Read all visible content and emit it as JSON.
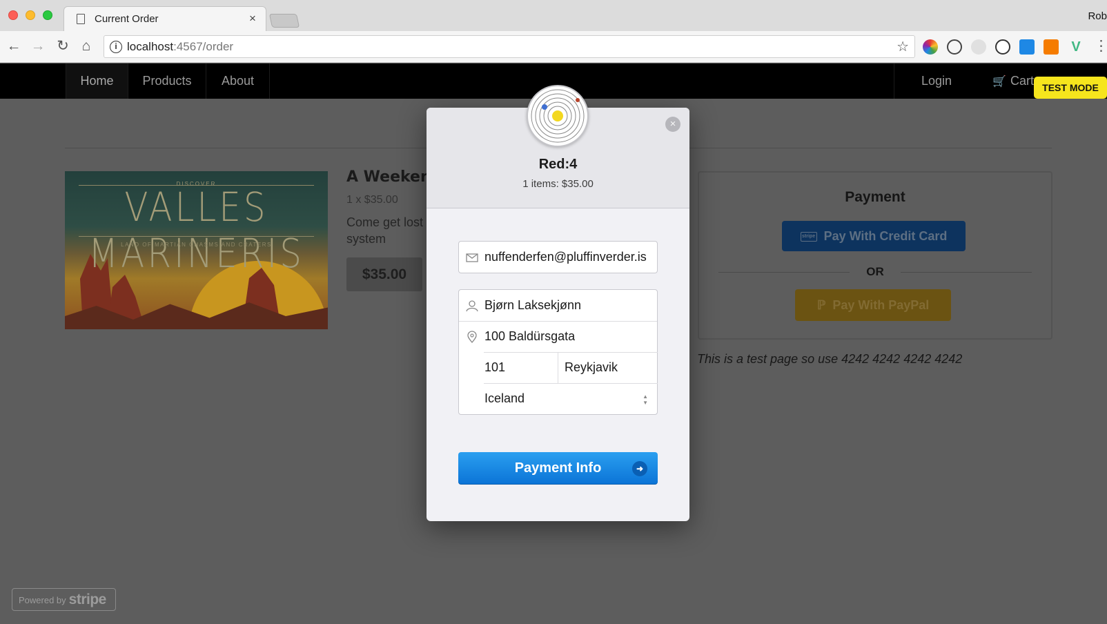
{
  "browser": {
    "tab_title": "Current Order",
    "tab_close": "×",
    "user_name": "Rob",
    "url_host": "localhost",
    "url_rest": ":4567/order"
  },
  "site_nav": {
    "items": [
      "Home",
      "Products",
      "About"
    ],
    "login": "Login",
    "cart": "Cart",
    "test_mode": "TEST MODE"
  },
  "product": {
    "poster_kicker": "DISCOVER",
    "poster_title": "VALLES MARINERIS",
    "poster_subtitle": "LAND OF MARTIAN CHASMS AND CRATERS",
    "title": "A Weekend",
    "qty_price": "1 x $35.00",
    "description": "Come get lost system",
    "price": "$35.00"
  },
  "payment_panel": {
    "heading": "Payment",
    "credit_card_label": "Pay With Credit Card",
    "stripe_mark": "stripe",
    "or_label": "OR",
    "paypal_label": "Pay With PayPal",
    "test_note": "This is a test page so use 4242 4242 4242 4242"
  },
  "powered_by": {
    "prefix": "Powered by",
    "brand": "stripe"
  },
  "modal": {
    "store_name": "Red:4",
    "summary": "1 items: $35.00",
    "close": "×",
    "email": "nuffenderfen@pluffinverder.is",
    "name": "Bjørn Laksekjønn",
    "street": "100 Baldürsgata",
    "postal": "101",
    "city": "Reykjavik",
    "country": "Iceland",
    "submit_label": "Payment Info"
  },
  "colors": {
    "stripe_blue": "#0b73d6",
    "test_mode_yellow": "#f6e51d",
    "credit_card_btn": "#0d335e",
    "paypal_btn": "#6b5312"
  }
}
